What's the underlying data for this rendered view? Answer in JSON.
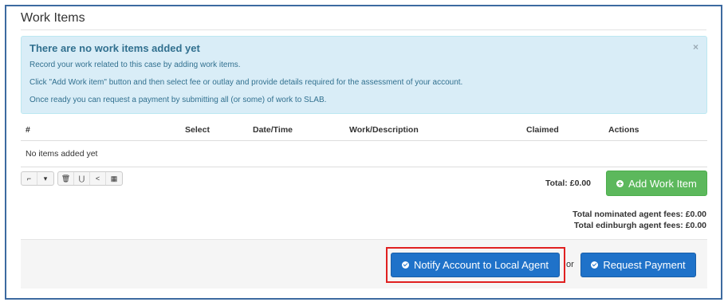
{
  "panel": {
    "title": "Work Items"
  },
  "alert": {
    "title": "There are no work items added yet",
    "lines": [
      "Record your work related to this case by adding work items.",
      "Click \"Add Work item\" button and then select fee or outlay and provide details required for the assessment of your account.",
      "Once ready you can request a payment by submitting all (or some) of work to SLAB."
    ],
    "close": "×"
  },
  "table": {
    "columns": [
      "#",
      "Select",
      "Date/Time",
      "Work/Description",
      "Claimed",
      "Actions"
    ],
    "empty_text": "No items added yet"
  },
  "toolbar": {
    "icons": [
      "checkbox-icon",
      "caret-down-icon",
      "trash-icon",
      "merge-icon",
      "share-icon",
      "grid-icon"
    ],
    "glyphs": [
      "⌐",
      "▾",
      "🗑",
      "⋃",
      "<",
      "▦"
    ]
  },
  "totals": {
    "total_label": "Total:",
    "total_value": "£0.00",
    "nominated_label": "Total nominated agent fees:",
    "nominated_value": "£0.00",
    "edinburgh_label": "Total edinburgh agent fees:",
    "edinburgh_value": "£0.00"
  },
  "buttons": {
    "add_work_item": "Add Work Item",
    "notify": "Notify Account to Local Agent",
    "or": "or",
    "request_payment": "Request Payment"
  },
  "colors": {
    "alert_bg": "#d9edf7",
    "alert_text": "#31708f",
    "success": "#5cb85c",
    "primary": "#1f72c9",
    "highlight": "#e02020",
    "frame_border": "#3d6aa0"
  }
}
